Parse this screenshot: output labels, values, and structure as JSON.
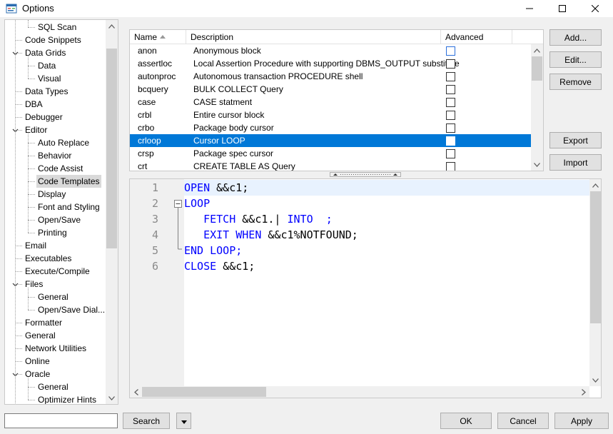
{
  "window": {
    "title": "Options"
  },
  "tree": {
    "items": [
      {
        "label": "SQL Scan",
        "level": 2
      },
      {
        "label": "Code Snippets",
        "level": 1
      },
      {
        "label": "Data Grids",
        "level": 1,
        "expander": "collapse"
      },
      {
        "label": "Data",
        "level": 2
      },
      {
        "label": "Visual",
        "level": 2
      },
      {
        "label": "Data Types",
        "level": 1
      },
      {
        "label": "DBA",
        "level": 1
      },
      {
        "label": "Debugger",
        "level": 1
      },
      {
        "label": "Editor",
        "level": 1,
        "expander": "collapse"
      },
      {
        "label": "Auto Replace",
        "level": 2
      },
      {
        "label": "Behavior",
        "level": 2
      },
      {
        "label": "Code Assist",
        "level": 2
      },
      {
        "label": "Code Templates",
        "level": 2,
        "selected": true
      },
      {
        "label": "Display",
        "level": 2
      },
      {
        "label": "Font and Styling",
        "level": 2
      },
      {
        "label": "Open/Save",
        "level": 2
      },
      {
        "label": "Printing",
        "level": 2
      },
      {
        "label": "Email",
        "level": 1
      },
      {
        "label": "Executables",
        "level": 1
      },
      {
        "label": "Execute/Compile",
        "level": 1
      },
      {
        "label": "Files",
        "level": 1,
        "expander": "collapse"
      },
      {
        "label": "General",
        "level": 2
      },
      {
        "label": "Open/Save Dial...",
        "level": 2
      },
      {
        "label": "Formatter",
        "level": 1
      },
      {
        "label": "General",
        "level": 1
      },
      {
        "label": "Network Utilities",
        "level": 1
      },
      {
        "label": "Online",
        "level": 1
      },
      {
        "label": "Oracle",
        "level": 1,
        "expander": "collapse"
      },
      {
        "label": "General",
        "level": 2
      },
      {
        "label": "Optimizer Hints",
        "level": 2
      }
    ]
  },
  "templates": {
    "columns": {
      "name": "Name",
      "description": "Description",
      "advanced": "Advanced"
    },
    "rows": [
      {
        "name": "anon",
        "description": "Anonymous block",
        "advanced": false
      },
      {
        "name": "assertloc",
        "description": "Local Assertion Procedure with supporting DBMS_OUTPUT substitute",
        "advanced": false
      },
      {
        "name": "autonproc",
        "description": "Autonomous transaction PROCEDURE shell",
        "advanced": false
      },
      {
        "name": "bcquery",
        "description": "BULK COLLECT Query",
        "advanced": false
      },
      {
        "name": "case",
        "description": "CASE statment",
        "advanced": false
      },
      {
        "name": "crbl",
        "description": "Entire cursor block",
        "advanced": false
      },
      {
        "name": "crbo",
        "description": "Package body cursor",
        "advanced": false
      },
      {
        "name": "crloop",
        "description": "Cursor LOOP",
        "advanced": false,
        "selected": true
      },
      {
        "name": "crsp",
        "description": "Package spec cursor",
        "advanced": false
      },
      {
        "name": "crt",
        "description": "CREATE TABLE AS Query",
        "advanced": false
      }
    ]
  },
  "actions": {
    "add": "Add...",
    "edit": "Edit...",
    "remove": "Remove",
    "export": "Export",
    "import": "Import"
  },
  "editor": {
    "lines": [
      {
        "num": "1",
        "text": "OPEN &&c1;"
      },
      {
        "num": "2",
        "text": "LOOP"
      },
      {
        "num": "3",
        "text": "   FETCH &&c1.| INTO  ;"
      },
      {
        "num": "4",
        "text": "   EXIT WHEN &&c1%NOTFOUND;"
      },
      {
        "num": "5",
        "text": "END LOOP;"
      },
      {
        "num": "6",
        "text": "CLOSE &&c1;"
      }
    ]
  },
  "footer": {
    "search_value": "",
    "search_label": "Search",
    "ok": "OK",
    "cancel": "Cancel",
    "apply": "Apply"
  },
  "colors": {
    "selection": "#0078d7",
    "keyword": "#0000ff",
    "current_line": "#e8f2fe"
  }
}
